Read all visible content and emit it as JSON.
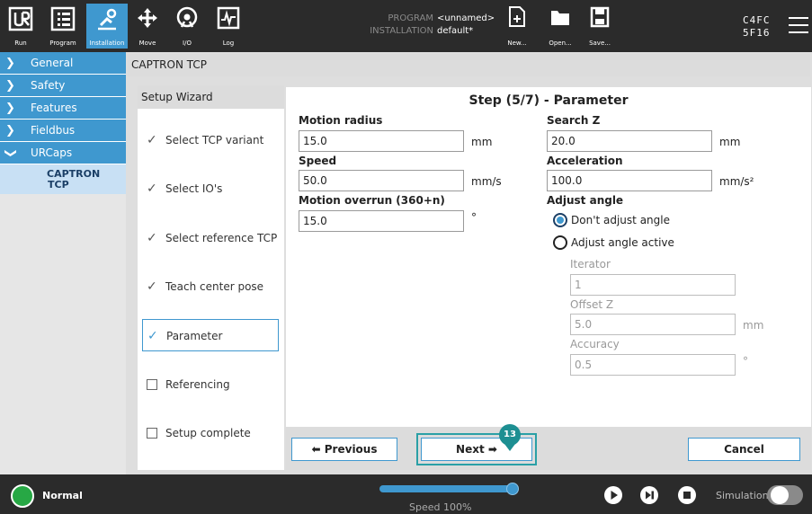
{
  "topbar": {
    "buttons": [
      {
        "label": "Run",
        "icon": "ur-logo-icon"
      },
      {
        "label": "Program",
        "icon": "program-icon"
      },
      {
        "label": "Installation",
        "icon": "installation-icon"
      },
      {
        "label": "Move",
        "icon": "move-icon"
      },
      {
        "label": "I/O",
        "icon": "io-icon"
      },
      {
        "label": "Log",
        "icon": "log-icon"
      }
    ],
    "program_key": "PROGRAM",
    "program_value": "<unnamed>",
    "installation_key": "INSTALLATION",
    "installation_value": "default*",
    "file_buttons": [
      {
        "label": "New...",
        "icon": "new-file-icon"
      },
      {
        "label": "Open...",
        "icon": "open-folder-icon"
      },
      {
        "label": "Save...",
        "icon": "save-icon"
      }
    ],
    "robot_id_line1": "C4FC",
    "robot_id_line2": "5F16"
  },
  "sidebar": {
    "items": [
      {
        "label": "General"
      },
      {
        "label": "Safety"
      },
      {
        "label": "Features"
      },
      {
        "label": "Fieldbus"
      },
      {
        "label": "URCaps"
      }
    ],
    "sub_item": {
      "line1": "CAPTRON",
      "line2": "TCP"
    }
  },
  "main": {
    "section_title": "CAPTRON TCP",
    "wizard_title": "Setup Wizard",
    "steps": [
      {
        "label": "Select TCP variant",
        "state": "done"
      },
      {
        "label": "Select IO's",
        "state": "done"
      },
      {
        "label": "Select reference TCP",
        "state": "done"
      },
      {
        "label": "Teach center pose",
        "state": "done"
      },
      {
        "label": "Parameter",
        "state": "active"
      },
      {
        "label": "Referencing",
        "state": "todo"
      },
      {
        "label": "Setup complete",
        "state": "todo"
      }
    ]
  },
  "panel": {
    "step_title": "Step (5/7) - Parameter",
    "motion_radius": {
      "label": "Motion radius",
      "value": "15.0",
      "unit": "mm"
    },
    "speed": {
      "label": "Speed",
      "value": "50.0",
      "unit": "mm/s"
    },
    "motion_overrun": {
      "label": "Motion overrun (360+n)",
      "value": "15.0",
      "unit": "°"
    },
    "search_z": {
      "label": "Search Z",
      "value": "20.0",
      "unit": "mm"
    },
    "acceleration": {
      "label": "Acceleration",
      "value": "100.0",
      "unit": "mm/s²"
    },
    "adjust_angle": {
      "label": "Adjust angle",
      "option1": "Don't adjust angle",
      "option2": "Adjust angle active",
      "selected": "Don't adjust angle"
    },
    "iterator": {
      "label": "Iterator",
      "value": "1"
    },
    "offset_z": {
      "label": "Offset Z",
      "value": "5.0",
      "unit": "mm"
    },
    "accuracy": {
      "label": "Accuracy",
      "value": "0.5",
      "unit": "°"
    },
    "previous_label": "Previous",
    "next_label": "Next",
    "cancel_label": "Cancel",
    "marker_number": "13"
  },
  "bottombar": {
    "status": "Normal",
    "speed_label": "Speed 100%",
    "speed_fraction": 1.0,
    "simulation_label": "Simulation",
    "simulation_on": false
  },
  "colors": {
    "accent": "#3f98cf",
    "marker": "#1d8f92",
    "power_on": "#27a845",
    "bar": "#2b2b2b"
  }
}
